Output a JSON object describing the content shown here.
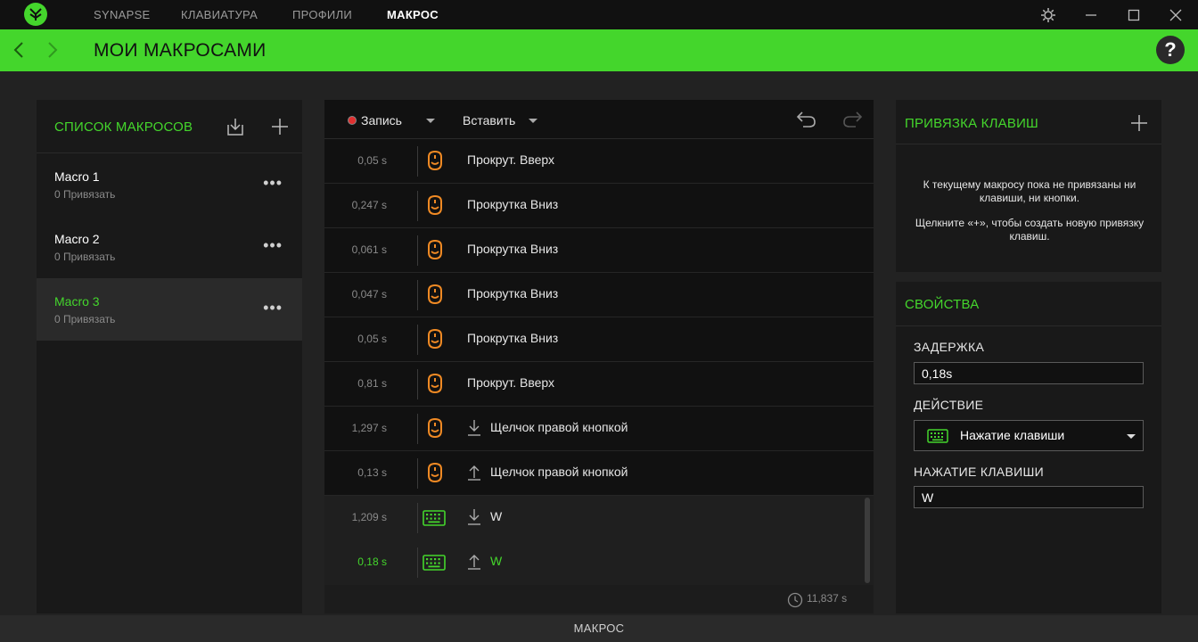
{
  "titlebar": {
    "tabs": [
      {
        "label": "SYNAPSE"
      },
      {
        "label": "КЛАВИАТУРА"
      },
      {
        "label": "ПРОФИЛИ"
      },
      {
        "label": "МАКРОС"
      }
    ],
    "active_tab": "МАКРОС"
  },
  "header": {
    "title": "МОИ МАКРОСАМИ",
    "help_label": "?"
  },
  "macro_list": {
    "title": "СПИСОК МАКРОСОВ",
    "items": [
      {
        "name": "Macro 1",
        "sub": "0 Привязать"
      },
      {
        "name": "Macro 2",
        "sub": "0 Привязать"
      },
      {
        "name": "Macro 3",
        "sub": "0 Привязать",
        "active": true
      }
    ],
    "more_label": "•••"
  },
  "editor": {
    "record_label": "Запись",
    "insert_label": "Вставить",
    "rows": [
      {
        "time": "0,05 s",
        "device": "mouse",
        "action": "Прокрут. Вверх",
        "arrow": ""
      },
      {
        "time": "0,247 s",
        "device": "mouse",
        "action": "Прокрутка Вниз",
        "arrow": ""
      },
      {
        "time": "0,061 s",
        "device": "mouse",
        "action": "Прокрутка Вниз",
        "arrow": ""
      },
      {
        "time": "0,047 s",
        "device": "mouse",
        "action": "Прокрутка Вниз",
        "arrow": ""
      },
      {
        "time": "0,05 s",
        "device": "mouse",
        "action": "Прокрутка Вниз",
        "arrow": ""
      },
      {
        "time": "0,81 s",
        "device": "mouse",
        "action": "Прокрут. Вверх",
        "arrow": ""
      },
      {
        "time": "1,297 s",
        "device": "mouse",
        "action": "Щелчок правой кнопкой",
        "arrow": "down"
      },
      {
        "time": "0,13 s",
        "device": "mouse",
        "action": "Щелчок правой кнопкой",
        "arrow": "up"
      },
      {
        "time": "1,209 s",
        "device": "keyboard",
        "action": "W",
        "arrow": "down"
      },
      {
        "time": "0,18 s",
        "device": "keyboard",
        "action": "W",
        "arrow": "up",
        "selected": true
      }
    ],
    "total_time": "11,837 s"
  },
  "key_binding": {
    "title": "ПРИВЯЗКА КЛАВИШ",
    "message_1": "К текущему макросу пока не привязаны ни клавиши, ни кнопки.",
    "message_2": "Щелкните «+», чтобы создать новую привязку клавиш."
  },
  "properties": {
    "title": "СВОЙСТВА",
    "delay_label": "ЗАДЕРЖКА",
    "delay_value": "0,18s",
    "action_label": "ДЕЙСТВИЕ",
    "action_value": "Нажатие клавиши",
    "key_label": "НАЖАТИЕ КЛАВИШИ",
    "key_value": "W"
  },
  "statusbar": {
    "label": "МАКРОС"
  },
  "colors": {
    "accent": "#44d62c",
    "mouse_icon": "#f08a24",
    "background": "#222222"
  }
}
